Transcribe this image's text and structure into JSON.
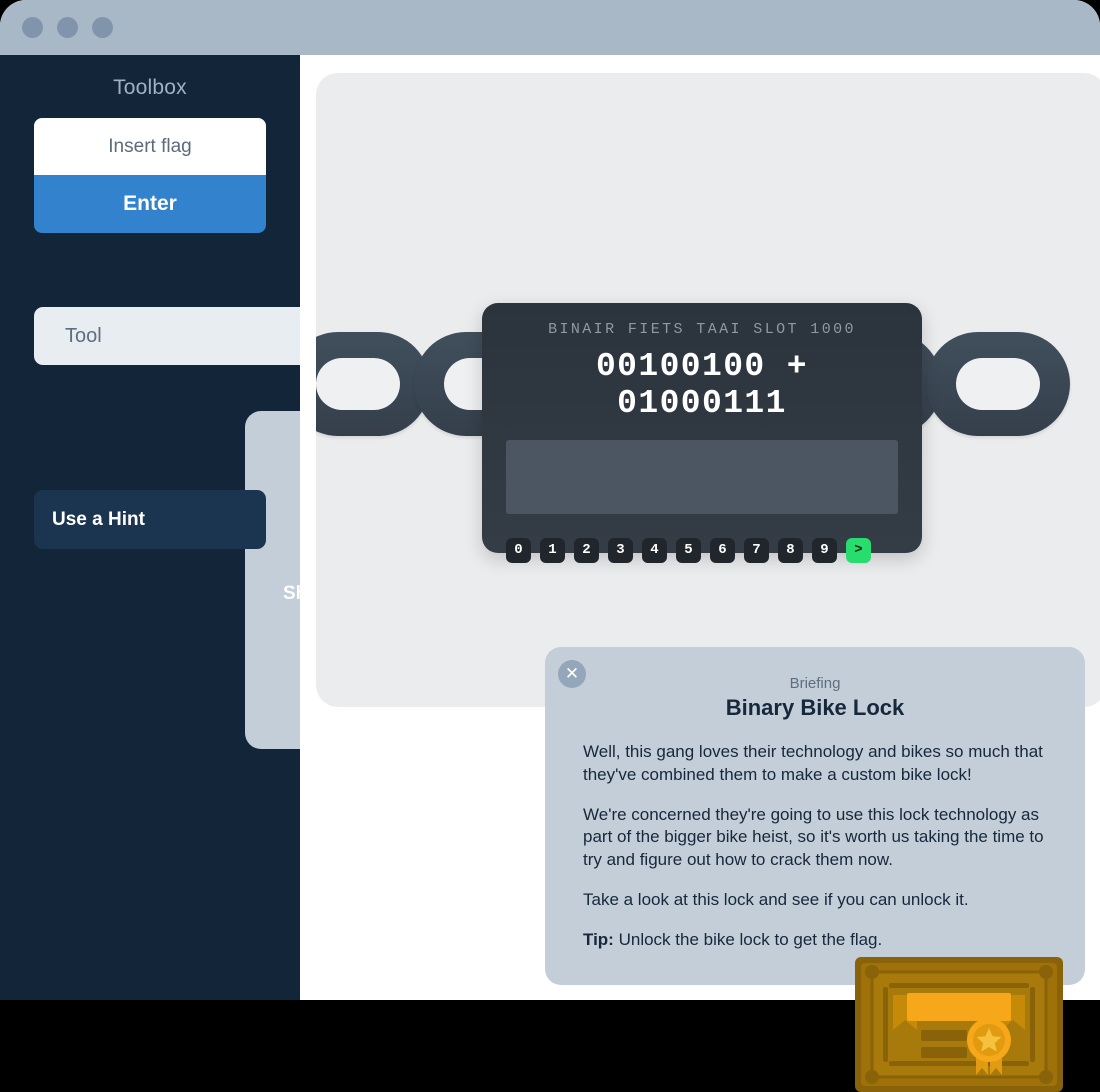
{
  "titlebar": {
    "dots": [
      "window-dot-1",
      "window-dot-2",
      "window-dot-3"
    ]
  },
  "sidebar": {
    "title": "Toolbox",
    "flag_input_placeholder": "Insert flag",
    "enter_label": "Enter",
    "tool_label": "Tool",
    "buttons": [
      {
        "label": "Show Briefing",
        "name": "show-briefing-button"
      },
      {
        "label": "Use a Hint",
        "name": "use-a-hint-button"
      }
    ]
  },
  "lock": {
    "header": "BINAIR FIETS TAAI SLOT 1000",
    "equation": "00100100 + 01000111",
    "screen_value": "",
    "keys": [
      "0",
      "1",
      "2",
      "3",
      "4",
      "5",
      "6",
      "7",
      "8",
      "9"
    ],
    "submit_label": ">",
    "submit_color": "#26dd6e"
  },
  "briefing": {
    "close_label": "✕",
    "kicker": "Briefing",
    "title": "Binary Bike Lock",
    "paragraph_1": "Well, this gang loves their technology and bikes so much that they've combined them to make a custom bike lock!",
    "paragraph_2": "We're concerned they're going to use this lock technology as part of the bigger bike heist, so it's worth us taking the time to try and figure out how to crack them now.",
    "paragraph_3": "Take a look at this lock and see if you can unlock it.",
    "tip_label": "Tip:",
    "tip_text": " Unlock the bike lock to get the flag."
  },
  "badge": {
    "name": "award-certificate-badge"
  },
  "colors": {
    "sidebar_bg": "#132639",
    "titlebar_bg": "#a9b8c7",
    "accent_blue": "#3282cd",
    "stage_bg": "#ebecee",
    "lock_bg": "#2b333c",
    "briefing_bg": "#c3ced8",
    "badge_gold": "#f6a71a"
  }
}
